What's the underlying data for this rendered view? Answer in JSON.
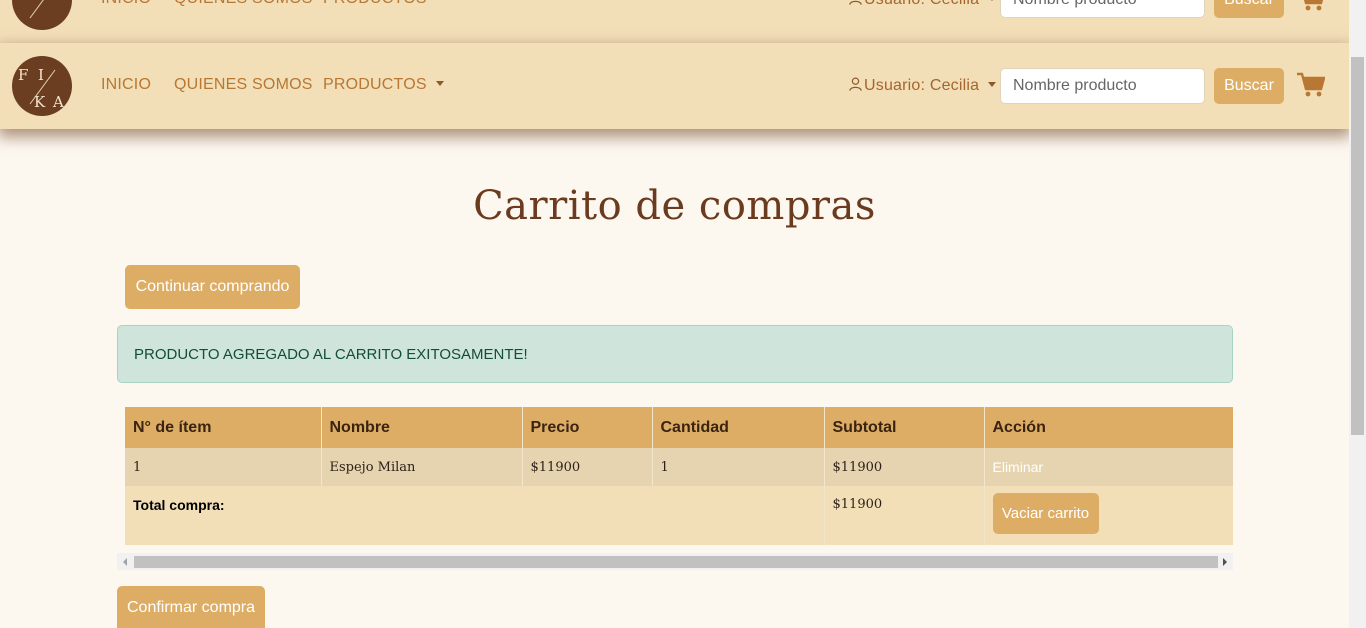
{
  "brand": {
    "logo_text": [
      "F",
      "I",
      "K",
      "A"
    ]
  },
  "nav": {
    "inicio": "INICIO",
    "quienes_somos": "QUIENES SOMOS",
    "productos": "PRODUCTOS",
    "user": "Usuario: Cecilia",
    "search_placeholder": "Nombre producto",
    "search_button": "Buscar",
    "cart_icon": "shopping-cart-icon",
    "user_icon": "user-icon"
  },
  "page": {
    "title": "Carrito de compras",
    "continue_button": "Continuar comprando",
    "alert": "PRODUCTO AGREGADO AL CARRITO EXITOSAMENTE!",
    "confirm_button": "Confirmar compra"
  },
  "table": {
    "headers": [
      "N° de ítem",
      "Nombre",
      "Precio",
      "Cantidad",
      "Subtotal",
      "Acción"
    ],
    "rows": [
      {
        "item": "1",
        "nombre": "Espejo Milan",
        "precio": "$11900",
        "cantidad": "1",
        "subtotal": "$11900",
        "accion": "Eliminar"
      }
    ],
    "total_label": "Total compra:",
    "total_value": "$11900",
    "empty_button": "Vaciar carrito"
  },
  "colors": {
    "navbar": "#f2dfb8",
    "accent": "#ddad66",
    "title": "#6b3b1f",
    "alert_bg": "#cfe5dc",
    "page_bg": "#fcf8f0"
  }
}
